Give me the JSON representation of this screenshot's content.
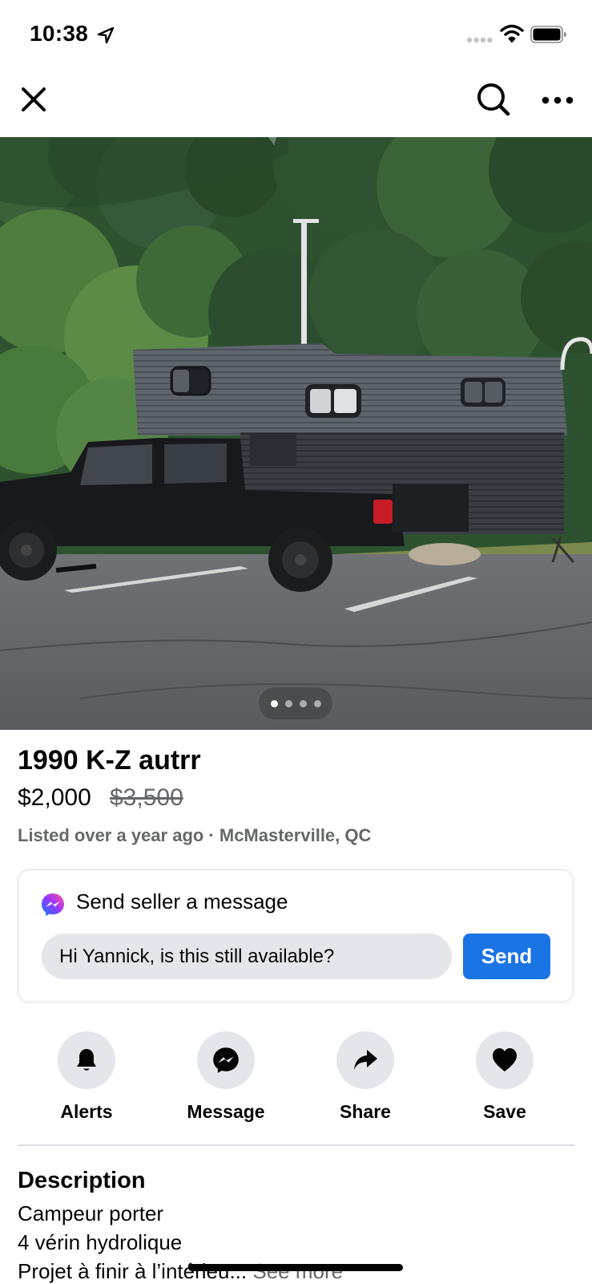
{
  "status_bar": {
    "time": "10:38"
  },
  "nav": {
    "close_icon": "close-icon",
    "search_icon": "search-icon",
    "more_icon": "more-horizontal-icon"
  },
  "photo": {
    "pager_count": 4,
    "pager_active_index": 0
  },
  "listing": {
    "title": "1990 K-Z autrr",
    "price": "$2,000",
    "original_price": "$3,500",
    "meta": "Listed over a year ago · McMasterville, QC"
  },
  "message_card": {
    "title": "Send seller a message",
    "input_value": "Hi Yannick, is this still available?",
    "send_label": "Send"
  },
  "actions": [
    {
      "label": "Alerts",
      "icon": "bell-icon"
    },
    {
      "label": "Message",
      "icon": "messenger-icon"
    },
    {
      "label": "Share",
      "icon": "share-arrow-icon"
    },
    {
      "label": "Save",
      "icon": "heart-icon"
    }
  ],
  "description": {
    "heading": "Description",
    "lines": [
      "Campeur porter",
      "4 vérin hydrolique",
      "Projet à finir à l’intérieu..."
    ],
    "see_more": "See more"
  },
  "colors": {
    "accent": "#1b74e4",
    "secondary_text": "#65676b",
    "button_bg": "#e4e6eb"
  }
}
